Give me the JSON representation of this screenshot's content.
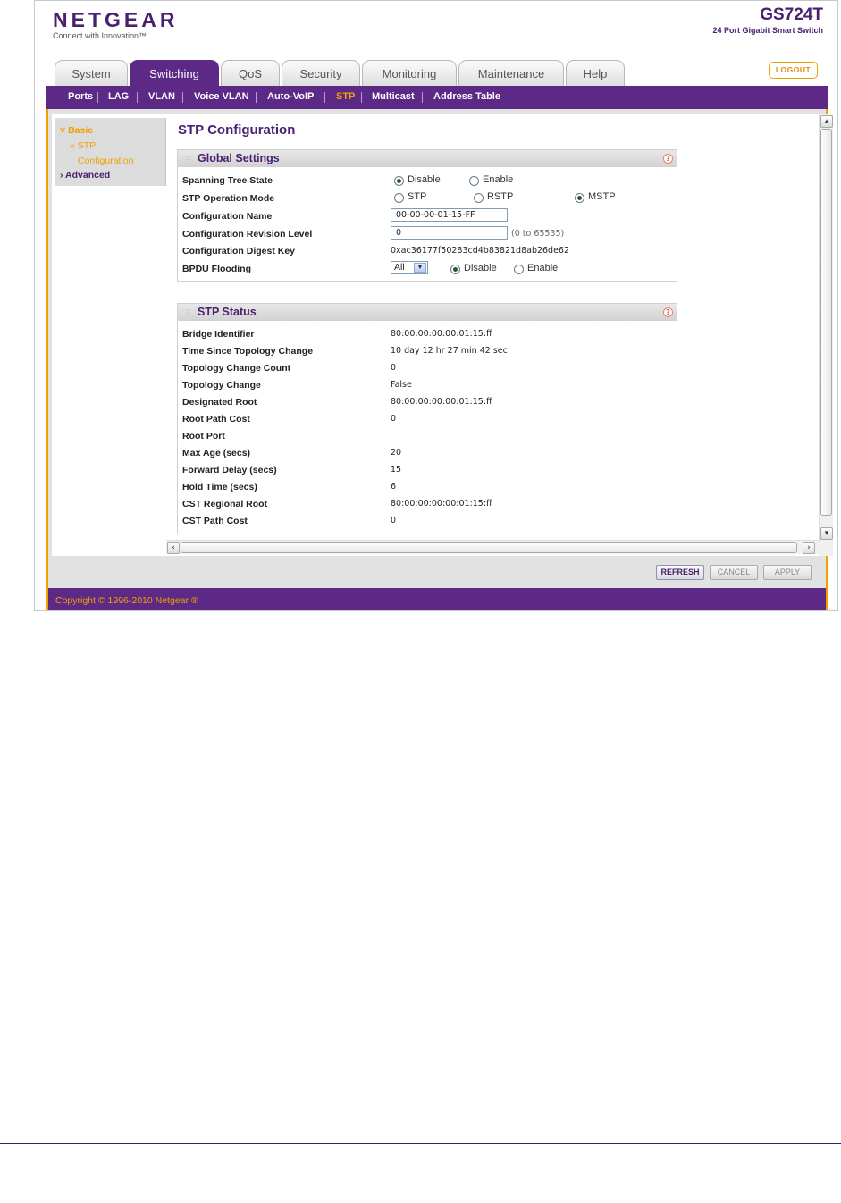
{
  "header": {
    "brand": "NETGEAR",
    "tagline": "Connect with Innovation™",
    "model": "GS724T",
    "model_desc": "24 Port Gigabit Smart Switch",
    "logout": "LOGOUT"
  },
  "tabs": [
    "System",
    "Switching",
    "QoS",
    "Security",
    "Monitoring",
    "Maintenance",
    "Help"
  ],
  "active_tab": "Switching",
  "subnav": [
    "Ports",
    "LAG",
    "VLAN",
    "Voice VLAN",
    "Auto-VoIP",
    "STP",
    "Multicast",
    "Address Table"
  ],
  "active_subnav": "STP",
  "leftnav": {
    "basic": "Basic",
    "stp": "STP",
    "stp_config": "Configuration",
    "advanced": "Advanced"
  },
  "page_title": "STP Configuration",
  "global_settings": {
    "title": "Global Settings",
    "spanning_tree_state_label": "Spanning Tree State",
    "state_disable": "Disable",
    "state_enable": "Enable",
    "state_selected": "Disable",
    "operation_mode_label": "STP Operation Mode",
    "mode_stp": "STP",
    "mode_rstp": "RSTP",
    "mode_mstp": "MSTP",
    "mode_selected": "MSTP",
    "config_name_label": "Configuration Name",
    "config_name_value": "00-00-00-01-15-FF",
    "config_revision_label": "Configuration Revision Level",
    "config_revision_value": "0",
    "config_revision_range": "(0 to 65535)",
    "digest_key_label": "Configuration Digest Key",
    "digest_key_value": "0xac36177f50283cd4b83821d8ab26de62",
    "bpdu_label": "BPDU Flooding",
    "bpdu_select": "All",
    "bpdu_disable": "Disable",
    "bpdu_enable": "Enable",
    "bpdu_selected": "Disable"
  },
  "stp_status": {
    "title": "STP Status",
    "rows": [
      {
        "label": "Bridge Identifier",
        "value": "80:00:00:00:00:01:15:ff"
      },
      {
        "label": "Time Since Topology Change",
        "value": "10 day 12 hr 27 min 42 sec"
      },
      {
        "label": "Topology Change Count",
        "value": "0"
      },
      {
        "label": "Topology Change",
        "value": "False"
      },
      {
        "label": "Designated Root",
        "value": "80:00:00:00:00:01:15:ff"
      },
      {
        "label": "Root Path Cost",
        "value": "0"
      },
      {
        "label": "Root Port",
        "value": ""
      },
      {
        "label": "Max Age (secs)",
        "value": "20"
      },
      {
        "label": "Forward Delay (secs)",
        "value": "15"
      },
      {
        "label": "Hold Time (secs)",
        "value": "6"
      },
      {
        "label": "CST Regional Root",
        "value": "80:00:00:00:00:01:15:ff"
      },
      {
        "label": "CST Path Cost",
        "value": "0"
      }
    ]
  },
  "buttons": {
    "refresh": "REFRESH",
    "cancel": "CANCEL",
    "apply": "APPLY"
  },
  "footer": "Copyright © 1996-2010 Netgear ®",
  "colors": {
    "brand_purple": "#5c2a86",
    "accent_orange": "#f0a000"
  }
}
